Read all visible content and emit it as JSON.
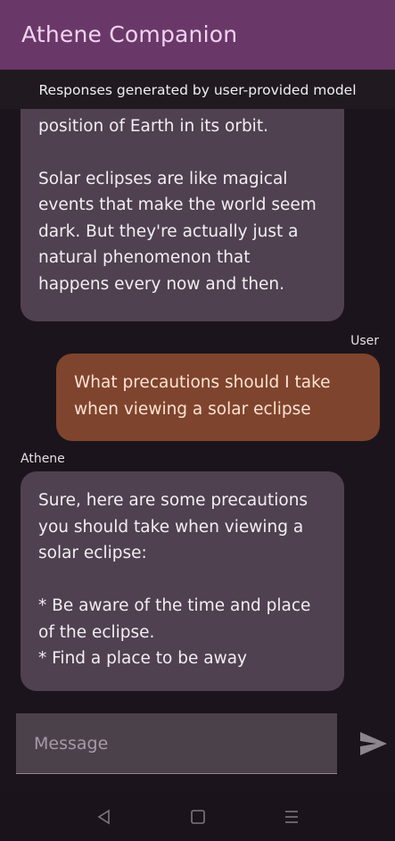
{
  "app": {
    "title": "Athene Companion"
  },
  "notice": {
    "text": "Responses generated by user-provided model"
  },
  "messages": [
    {
      "role": "assistant",
      "text": "or longer, depending on the\nposition of Earth in its orbit.\n\nSolar eclipses are like magical\nevents that make the world seem\ndark. But they're actually just a\nnatural phenomenon that\nhappens every now and then."
    },
    {
      "role": "user",
      "sender": "User",
      "text": "What precautions should I take\nwhen viewing a solar eclipse"
    },
    {
      "role": "assistant",
      "sender": "Athene",
      "text": "Sure, here are some precautions\nyou should take when viewing a\nsolar eclipse:\n\n* Be aware of the time and place\nof the eclipse.\n* Find a place to be away"
    }
  ],
  "composer": {
    "placeholder": "Message",
    "value": ""
  },
  "icons": {
    "send": "send-icon",
    "back": "back-triangle-icon",
    "home": "home-square-icon",
    "menu": "menu-lines-icon"
  },
  "colors": {
    "appbar": "#6a3868",
    "assistant_bubble": "#4f4150",
    "user_bubble": "#7f442d",
    "background": "#1c141c"
  }
}
